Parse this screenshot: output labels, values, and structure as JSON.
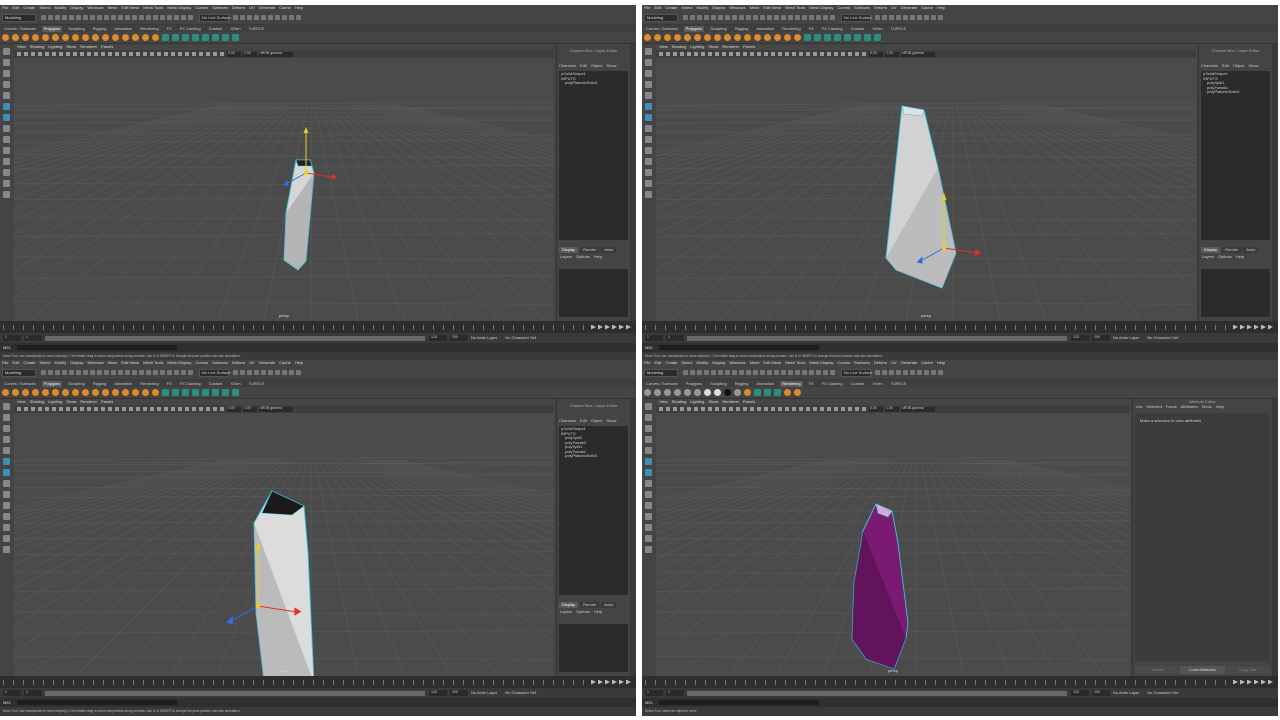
{
  "menus": {
    "main": [
      "File",
      "Edit",
      "Create",
      "Select",
      "Modify",
      "Display",
      "Windows",
      "Mesh",
      "Edit Mesh",
      "Mesh Tools",
      "Mesh Display",
      "Curves",
      "Surfaces",
      "Deform",
      "UV",
      "Generate",
      "Cache",
      "Help"
    ]
  },
  "toolbar": {
    "mode": "Modeling",
    "live_surface": "No Live Surface"
  },
  "shelf_tabs": [
    "Curves / Surfaces",
    "Polygons",
    "Sculpting",
    "Rigging",
    "Animation",
    "Rendering",
    "FX",
    "FX Caching",
    "Custom",
    "XGen",
    "TURTLE"
  ],
  "viewport": {
    "menu": [
      "View",
      "Shading",
      "Lighting",
      "Show",
      "Renderer",
      "Panels"
    ],
    "exposure": "0.00",
    "gamma": "1.00",
    "color_space": "sRGB gamma",
    "camera": "persp"
  },
  "channel_box": {
    "title": "Channel Box / Layer Editor",
    "menu": [
      "Channels",
      "Edit",
      "Object",
      "Show"
    ],
    "layer_tabs": [
      "Display",
      "Render",
      "Anim"
    ],
    "layer_menu": [
      "Layers",
      "Options",
      "Help"
    ]
  },
  "panes": [
    {
      "shelf_active": "Polygons",
      "nodes": [
        "pSolidShape1",
        "INPUTS",
        "polyPlatonicSolid1"
      ]
    },
    {
      "shelf_active": "Polygons",
      "nodes": [
        "pSolidShape1",
        "INPUTS",
        "polySplit1",
        "polyTweak1",
        "polyPlatonicSolid1"
      ]
    },
    {
      "shelf_active": "Polygons",
      "nodes": [
        "pSolidShape1",
        "INPUTS",
        "polySplit2",
        "polyTweak2",
        "polySplit1",
        "polyTweak1",
        "polyPlatonicSolid1"
      ]
    },
    {
      "shelf_active": "Rendering",
      "nodes": []
    }
  ],
  "attribute_editor": {
    "title": "Attribute Editor",
    "menu": [
      "List",
      "Selected",
      "Focus",
      "Attributes",
      "Show",
      "Help"
    ],
    "message": "Make a selection to view attributes",
    "buttons": [
      "Select",
      "Load Attributes",
      "Copy Tab"
    ]
  },
  "time": {
    "start": "1",
    "end": "120",
    "range_end": "120",
    "max": "200",
    "anim_layer": "No Anim Layer",
    "char_set": "No Character Set"
  },
  "command_line": {
    "label": "MEL"
  },
  "help_text": {
    "move": "Move Tool: Use manipulator to move object(s). Ctrl+middle-drag to move components along normals. Use D or INSERT to change the pivot position and axis orientation.",
    "select": "Select Tool: select an object to move"
  },
  "colors": {
    "selection": "#3ec6e0",
    "ui_bg": "#444444",
    "viewport_bg": "#4b4b4b",
    "shader_purple": "#7a1a72",
    "icon_orange": "#e08a2a"
  }
}
